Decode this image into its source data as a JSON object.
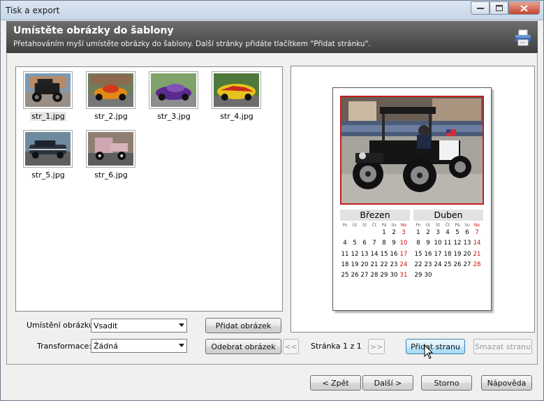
{
  "window": {
    "title": "Tisk a export"
  },
  "header": {
    "title": "Umístěte obrázky do šablony",
    "subtitle": "Přetahováním myší umístěte obrázky do šablony. Další stránky přidáte tlačítkem \"Přidat stránku\"."
  },
  "thumbnails": [
    {
      "name": "str_1.jpg",
      "selected": true
    },
    {
      "name": "str_2.jpg",
      "selected": false
    },
    {
      "name": "str_3.jpg",
      "selected": false
    },
    {
      "name": "str_4.jpg",
      "selected": false
    },
    {
      "name": "str_5.jpg",
      "selected": false
    },
    {
      "name": "str_6.jpg",
      "selected": false
    }
  ],
  "calendar": {
    "months": [
      {
        "name": "Březen",
        "dows": [
          "Po",
          "Út",
          "St",
          "Čt",
          "Pá",
          "So",
          "Ne"
        ],
        "weeks": [
          [
            "",
            "",
            "",
            "",
            "1",
            "2",
            "3"
          ],
          [
            "4",
            "5",
            "6",
            "7",
            "8",
            "9",
            "10"
          ],
          [
            "11",
            "12",
            "13",
            "14",
            "15",
            "16",
            "17"
          ],
          [
            "18",
            "19",
            "20",
            "21",
            "22",
            "23",
            "24"
          ],
          [
            "25",
            "26",
            "27",
            "28",
            "29",
            "30",
            "31"
          ]
        ]
      },
      {
        "name": "Duben",
        "dows": [
          "Po",
          "Út",
          "St",
          "Čt",
          "Pá",
          "So",
          "Ne"
        ],
        "weeks": [
          [
            "1",
            "2",
            "3",
            "4",
            "5",
            "6",
            "7"
          ],
          [
            "8",
            "9",
            "10",
            "11",
            "12",
            "13",
            "14"
          ],
          [
            "15",
            "16",
            "17",
            "18",
            "19",
            "20",
            "21"
          ],
          [
            "22",
            "23",
            "24",
            "25",
            "26",
            "27",
            "28"
          ],
          [
            "29",
            "30",
            "",
            "",
            "",
            "",
            ""
          ]
        ]
      }
    ]
  },
  "controls": {
    "placement_label": "Umístění obrázku:",
    "placement_value": "Vsadit",
    "transform_label": "Transformace:",
    "transform_value": "Žádná",
    "add_image": "Přidat obrázek",
    "remove_image": "Odebrat obrázek",
    "prev_page": "<<",
    "next_page": ">>",
    "page_info": "Stránka 1 z 1",
    "add_page": "Přidat stranu",
    "delete_page": "Smazat stranu"
  },
  "footer": {
    "back": "< Zpět",
    "next": "Další >",
    "cancel": "Storno",
    "help": "Nápověda"
  },
  "colors": {
    "header_bg": "#555555",
    "frame_red": "#c21d1d",
    "sunday_red": "#cc1111"
  }
}
